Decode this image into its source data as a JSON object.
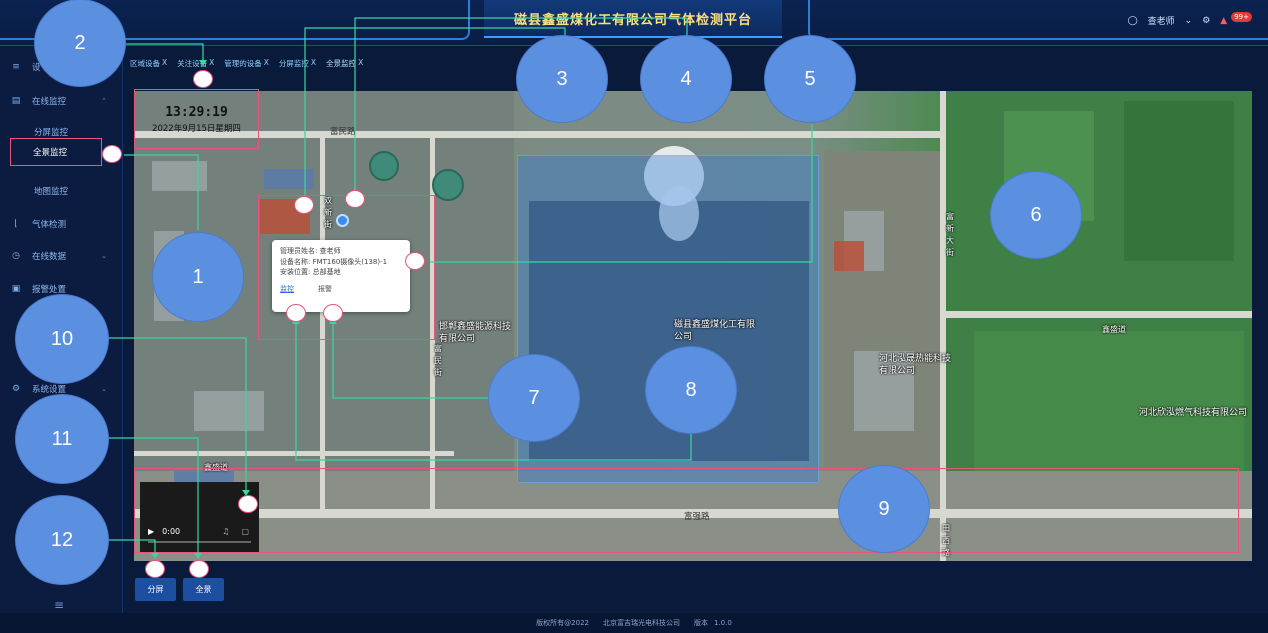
{
  "header": {
    "title": "磁县鑫盛煤化工有限公司气体检测平台",
    "user_name": "查老师",
    "notification_badge": "99+"
  },
  "sidebar": {
    "items": [
      {
        "label": "设",
        "icon": "sliders-icon"
      },
      {
        "label": "在线监控",
        "icon": "monitor-icon"
      },
      {
        "label": "气体检测",
        "icon": "thermometer-icon"
      },
      {
        "label": "在线数据",
        "icon": "clock-icon"
      },
      {
        "label": "报警处置",
        "icon": "alarm-icon"
      },
      {
        "label": "系统设置",
        "icon": "gear-icon"
      }
    ],
    "subitems": [
      {
        "label": "分屏监控"
      },
      {
        "label": "全景监控"
      },
      {
        "label": "地图监控"
      }
    ]
  },
  "tabs": [
    {
      "label": "区域设备",
      "close": "X"
    },
    {
      "label": "关注设备",
      "close": "X"
    },
    {
      "label": "管理的设备",
      "close": "X"
    },
    {
      "label": "分屏监控",
      "close": "X"
    },
    {
      "label": "全景监控",
      "close": "X"
    }
  ],
  "clock": {
    "time": "13:29:19",
    "date": "2022年9月15日星期四"
  },
  "popup": {
    "admin": "管理员姓名: 查老师",
    "device": "设备名称: FMT160摄像头(138)-1",
    "location": "安装位置: 总部基地",
    "monitor_link": "监控",
    "alarm_link": "报警"
  },
  "map": {
    "road_top": "富民路",
    "road_bottom": "富强路",
    "road_lower_left": "鑫盛道",
    "road_mid_right": "鑫盛道",
    "street_left": "双新街",
    "street_mid": "富民街",
    "street_right": "富新大街",
    "company_1": "邯郸鑫盛能源科技有限公司",
    "company_2": "磁县鑫盛煤化工有限公司",
    "company_3": "河北泓晟热能科技有限公司",
    "company_4": "河北欣泓燃气科技有限公司",
    "road_bottom_right": "田西路"
  },
  "video": {
    "time": "0:00"
  },
  "buttons": {
    "split": "分屏",
    "panorama": "全景"
  },
  "footer": {
    "copyright": "版权所有@2022",
    "company": "北京富吉瑞光电科技公司",
    "version_label": "版本",
    "version": "1.0.0"
  },
  "annotations": [
    "1",
    "2",
    "3",
    "4",
    "5",
    "6",
    "7",
    "8",
    "9",
    "10",
    "11",
    "12"
  ]
}
